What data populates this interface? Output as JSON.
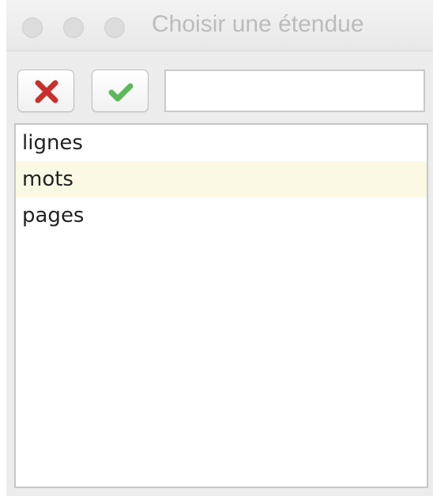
{
  "window": {
    "title": "Choisir une étendue"
  },
  "toolbar": {
    "cancel_icon": "red-x-icon",
    "confirm_icon": "green-checkmark-icon",
    "filter_value": "",
    "filter_placeholder": ""
  },
  "list": {
    "items": [
      {
        "label": "lignes",
        "selected": false
      },
      {
        "label": "mots",
        "selected": true
      },
      {
        "label": "pages",
        "selected": false
      }
    ]
  },
  "colors": {
    "cancel_red": "#c9302c",
    "confirm_green": "#5cb85c",
    "selection_highlight": "#fbf9e4"
  }
}
